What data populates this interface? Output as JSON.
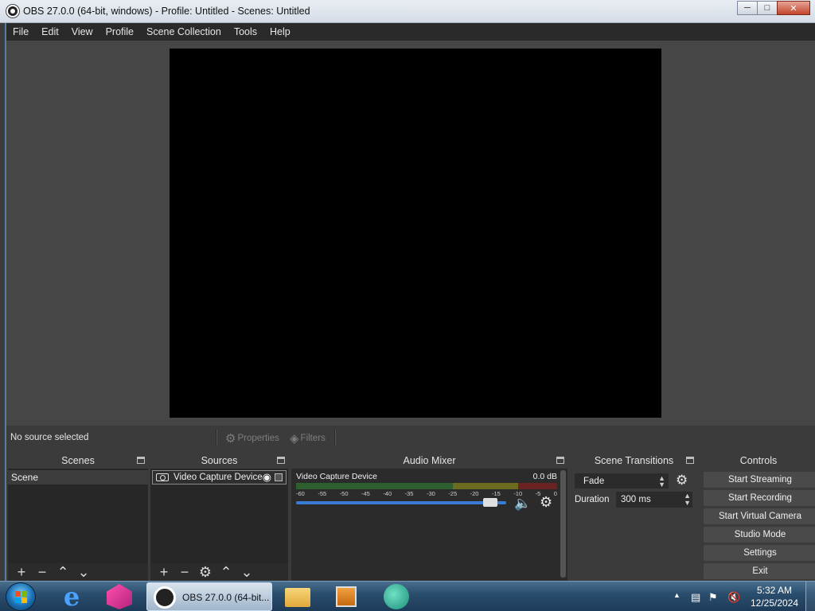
{
  "window": {
    "title": "OBS 27.0.0 (64-bit, windows) - Profile: Untitled - Scenes: Untitled",
    "minimize_icon": "minimize-icon",
    "maximize_icon": "maximize-icon",
    "close_icon": "close-icon"
  },
  "menu": [
    "File",
    "Edit",
    "View",
    "Profile",
    "Scene Collection",
    "Tools",
    "Help"
  ],
  "context": {
    "no_source": "No source selected",
    "properties": "Properties",
    "filters": "Filters"
  },
  "scenes": {
    "title": "Scenes",
    "items": [
      "Scene"
    ]
  },
  "sources": {
    "title": "Sources",
    "items": [
      "Video Capture Device"
    ]
  },
  "mixer": {
    "title": "Audio Mixer",
    "channel_name": "Video Capture Device",
    "db": "0.0 dB",
    "ticks": [
      "-60",
      "-55",
      "-50",
      "-45",
      "-40",
      "-35",
      "-30",
      "-25",
      "-20",
      "-15",
      "-10",
      "-5",
      "0"
    ],
    "volume_level": 0.95
  },
  "transitions": {
    "title": "Scene Transitions",
    "selected": "Fade",
    "duration_label": "Duration",
    "duration_value": "300 ms"
  },
  "controls": {
    "title": "Controls",
    "buttons": [
      "Start Streaming",
      "Start Recording",
      "Start Virtual Camera",
      "Studio Mode",
      "Settings",
      "Exit"
    ]
  },
  "taskbar": {
    "obs_label": "OBS 27.0.0 (64-bit...",
    "time": "5:32 AM",
    "date": "12/25/2024"
  },
  "colors": {
    "accent": "#3a7bd5",
    "panel": "#2b2b2b",
    "background": "#3b3b3b"
  }
}
